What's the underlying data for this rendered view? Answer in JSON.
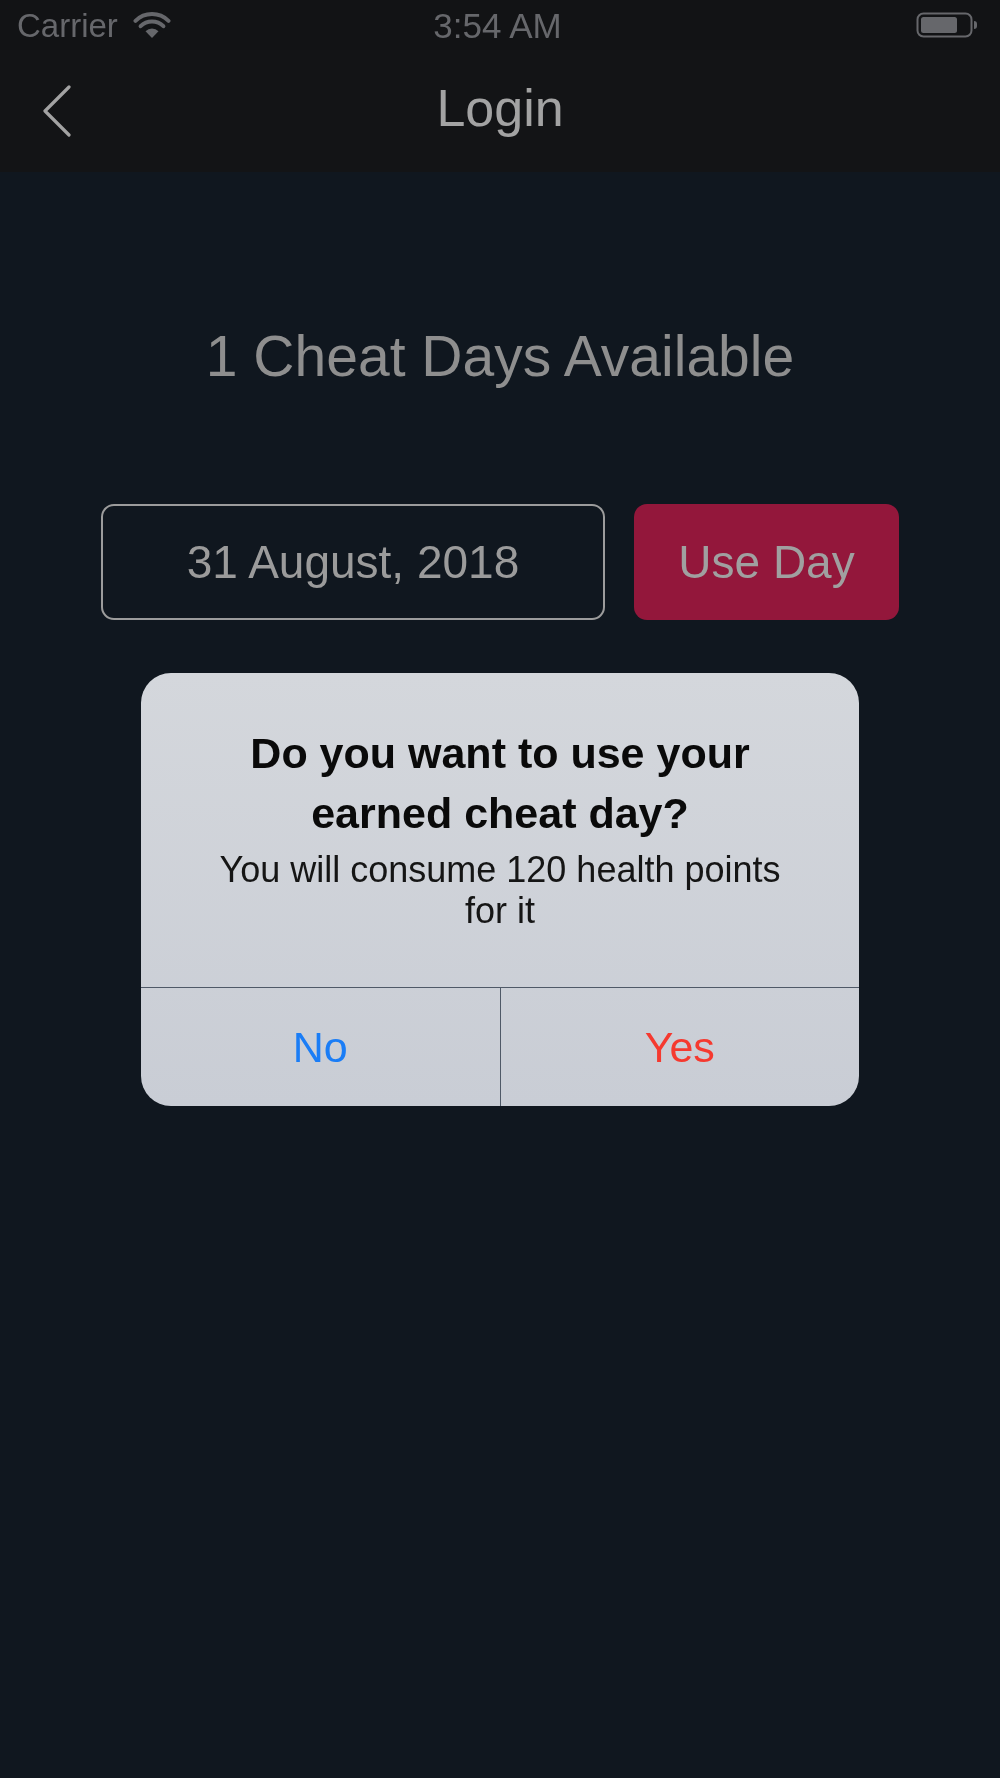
{
  "status_bar": {
    "carrier": "Carrier",
    "time": "3:54 AM"
  },
  "nav_bar": {
    "title": "Login"
  },
  "cheat_days": {
    "heading": "1 Cheat Days Available",
    "date_field": {
      "value": "31 August, 2018"
    },
    "use_day_button": {
      "label": "Use Day"
    }
  },
  "alert": {
    "title": "Do you want to use your earned cheat day?",
    "message": "You will consume 120 health points for it",
    "buttons": [
      {
        "label": "No",
        "kind": "cancel"
      },
      {
        "label": "Yes",
        "kind": "destructive"
      }
    ]
  }
}
